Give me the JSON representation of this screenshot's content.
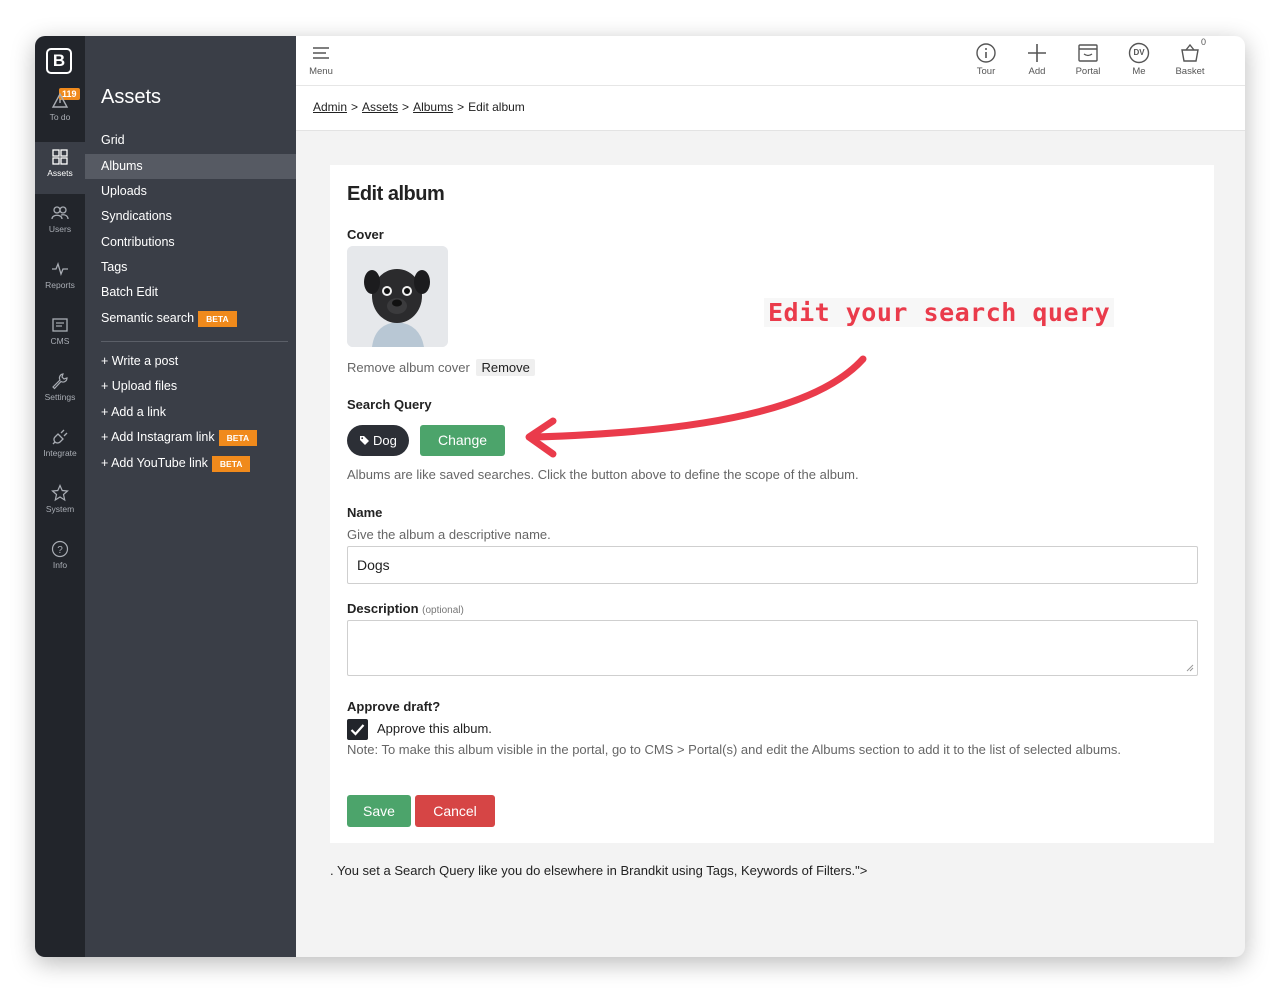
{
  "rail": {
    "logo": "B",
    "todo_badge": "119",
    "items": [
      {
        "label": "To do"
      },
      {
        "label": "Assets"
      },
      {
        "label": "Users"
      },
      {
        "label": "Reports"
      },
      {
        "label": "CMS"
      },
      {
        "label": "Settings"
      },
      {
        "label": "Integrate"
      },
      {
        "label": "System"
      },
      {
        "label": "Info"
      }
    ]
  },
  "nav": {
    "title": "Assets",
    "items": [
      {
        "label": "Grid"
      },
      {
        "label": "Albums"
      },
      {
        "label": "Uploads"
      },
      {
        "label": "Syndications"
      },
      {
        "label": "Contributions"
      },
      {
        "label": "Tags"
      },
      {
        "label": "Batch Edit"
      },
      {
        "label": "Semantic search",
        "badge": "BETA"
      }
    ],
    "actions": [
      {
        "label": "+ Write a post"
      },
      {
        "label": "+ Upload files"
      },
      {
        "label": "+ Add a link"
      },
      {
        "label": "+ Add Instagram link",
        "badge": "BETA"
      },
      {
        "label": "+ Add YouTube link",
        "badge": "BETA"
      }
    ]
  },
  "topbar": {
    "menu": "Menu",
    "tour": "Tour",
    "add": "Add",
    "portal": "Portal",
    "me": "Me",
    "me_initials": "DV",
    "basket": "Basket",
    "basket_count": "0"
  },
  "breadcrumb": {
    "items": [
      "Admin",
      "Assets",
      "Albums"
    ],
    "current": "Edit album",
    "separator": ">"
  },
  "form": {
    "title": "Edit album",
    "cover_label": "Cover",
    "remove_text": "Remove album cover",
    "remove_button": "Remove",
    "search_query_label": "Search Query",
    "tag": "Dog",
    "change_button": "Change",
    "search_help": "Albums are like saved searches. Click the button above to define the scope of the album.",
    "name_label": "Name",
    "name_help": "Give the album a descriptive name.",
    "name_value": "Dogs",
    "description_label": "Description",
    "description_optional": "(optional)",
    "description_value": "",
    "approve_label": "Approve draft?",
    "approve_checkbox": "Approve this album.",
    "approve_checked": true,
    "approve_note": "Note: To make this album visible in the portal, go to CMS > Portal(s) and edit the Albums section to add it to the list of selected albums.",
    "save_button": "Save",
    "cancel_button": "Cancel"
  },
  "footnote": ". You set a Search Query like you do elsewhere in Brandkit using Tags, Keywords of Filters.\">",
  "annotation": {
    "text": "Edit your search query",
    "color": "#ea3b4b"
  },
  "colors": {
    "rail_bg": "#22252b",
    "nav_bg": "#3a3e47",
    "accent_orange": "#f08a1c",
    "success_green": "#4ca46b",
    "danger_red": "#d64545"
  }
}
